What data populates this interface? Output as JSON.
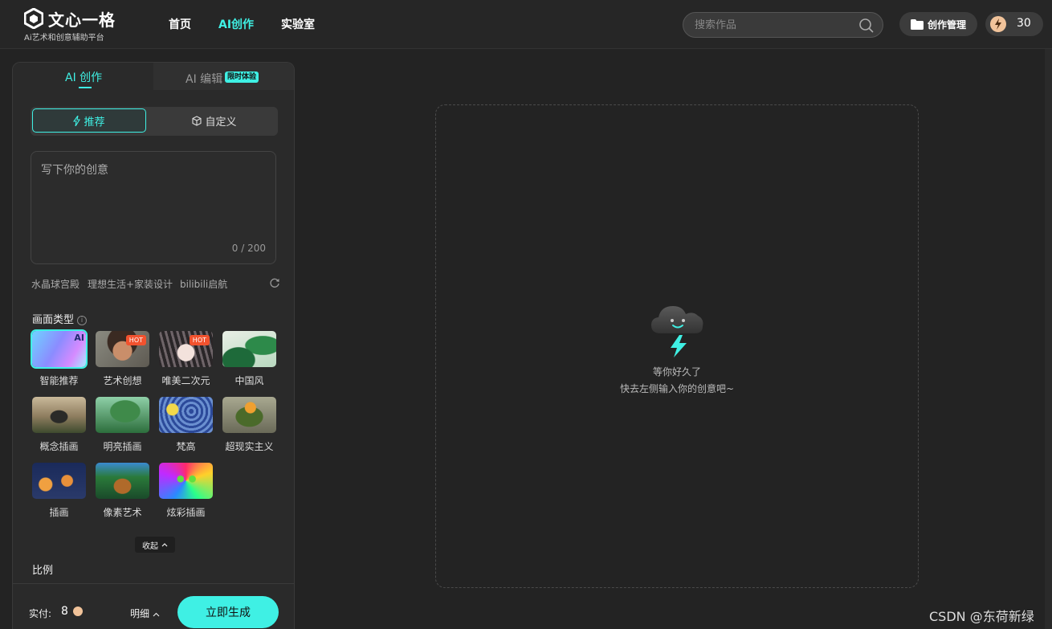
{
  "header": {
    "logo_title": "文心一格",
    "logo_sub": "Ai艺术和创意辅助平台",
    "nav": [
      {
        "label": "首页",
        "active": false
      },
      {
        "label": "AI创作",
        "active": true
      },
      {
        "label": "实验室",
        "active": false
      }
    ],
    "search_placeholder": "搜索作品",
    "manage_label": "创作管理",
    "credits": "30"
  },
  "panel": {
    "tab_create": "AI 创作",
    "tab_edit": "AI 编辑",
    "tab_edit_badge": "限时体验",
    "mode_recommend": "推荐",
    "mode_custom": "自定义",
    "prompt_placeholder": "写下你的创意",
    "prompt_count": "0 / 200",
    "suggestions": [
      "水晶球宫殿",
      "理想生活+家装设计",
      "bilibili启航"
    ],
    "style_section": "画面类型",
    "styles": [
      {
        "label": "智能推荐",
        "badge": "AI",
        "selected": true
      },
      {
        "label": "艺术创想",
        "badge": "HOT"
      },
      {
        "label": "唯美二次元",
        "badge": "HOT"
      },
      {
        "label": "中国风",
        "badge": ""
      },
      {
        "label": "概念插画",
        "badge": ""
      },
      {
        "label": "明亮插画",
        "badge": ""
      },
      {
        "label": "梵高",
        "badge": ""
      },
      {
        "label": "超现实主义",
        "badge": ""
      },
      {
        "label": "插画",
        "badge": ""
      },
      {
        "label": "像素艺术",
        "badge": ""
      },
      {
        "label": "炫彩插画",
        "badge": ""
      }
    ],
    "collapse_label": "收起",
    "ratio_section": "比例",
    "pay_label": "实付:",
    "pay_value": "8",
    "detail_label": "明细",
    "generate_label": "立即生成"
  },
  "canvas": {
    "empty_title": "等你好久了",
    "empty_sub": "快去左侧输入你的创意吧~"
  },
  "watermark": "CSDN @东荷新绿",
  "colors": {
    "accent": "#3ff0e4",
    "hot": "#f2522e",
    "background": "#232323"
  }
}
